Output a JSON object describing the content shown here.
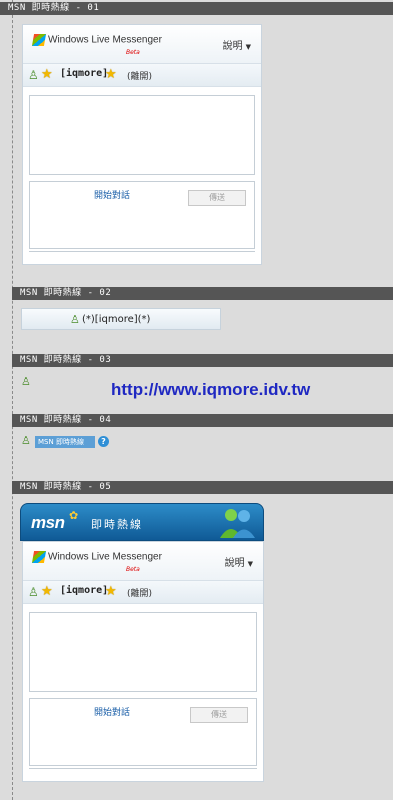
{
  "sections": [
    {
      "label": "MSN 即時熱線 - 01"
    },
    {
      "label": "MSN 即時熱線 - 02"
    },
    {
      "label": "MSN 即時熱線 - 03"
    },
    {
      "label": "MSN 即時熱線 - 04"
    },
    {
      "label": "MSN 即時熱線 - 05"
    }
  ],
  "messenger": {
    "logo_text": "Windows Live Messenger",
    "beta": "Beta",
    "help_label": "說明",
    "username": "[iqmore]",
    "status": "(離開)",
    "start_chat": "開始對話",
    "send_label": "傳送"
  },
  "section02": {
    "button_text": "(*)[iqmore](*)"
  },
  "section03": {
    "url": "http://www.iqmore.idv.tw"
  },
  "section04": {
    "tag_text": "MSN 即時熱線",
    "help_glyph": "?"
  },
  "section05": {
    "brand": "msn",
    "title": "即時熱線"
  },
  "icons": {
    "user": "user-icon",
    "star": "star-icon",
    "flag": "windows-flag-icon",
    "butterfly": "msn-butterfly-icon",
    "buddies": "msn-buddies-icon"
  }
}
